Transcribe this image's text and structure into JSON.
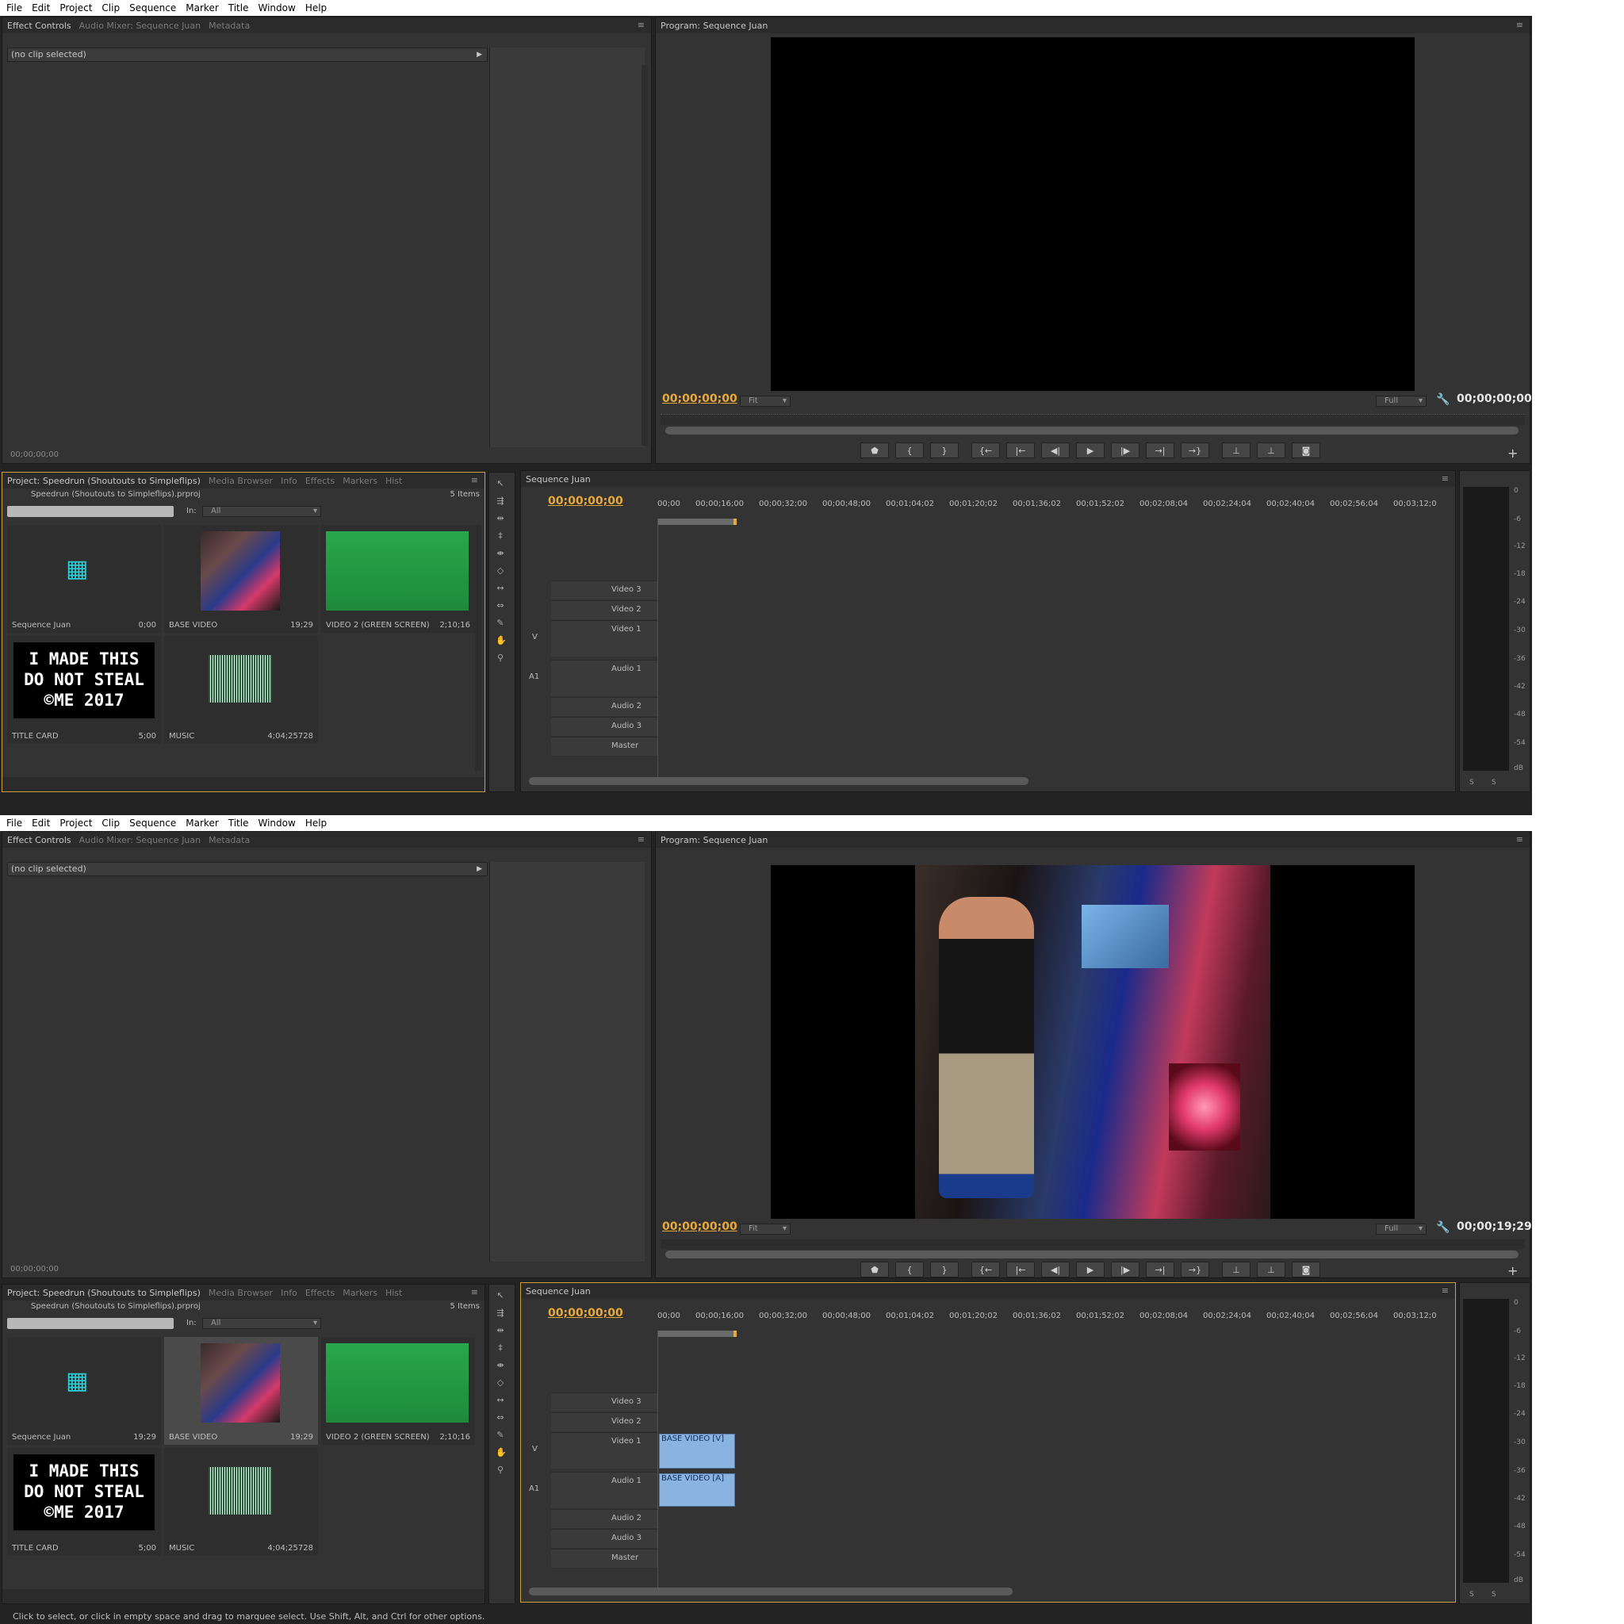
{
  "menu": [
    "File",
    "Edit",
    "Project",
    "Clip",
    "Sequence",
    "Marker",
    "Title",
    "Window",
    "Help"
  ],
  "effect_tabs": [
    "Effect Controls",
    "Audio Mixer: Sequence Juan",
    "Metadata"
  ],
  "no_clip": "(no clip selected)",
  "effect_time": "00;00;00;00",
  "program_tab": "Program: Sequence Juan",
  "program_in_time": "00;00;00;00",
  "fit": "Fit",
  "full": "Full",
  "project_tabs": [
    "Project: Speedrun (Shoutouts to Simpleflips)",
    "Media Browser",
    "Info",
    "Effects",
    "Markers",
    "Hist"
  ],
  "project_file": "Speedrun (Shoutouts to Simpleflips).prproj",
  "items_count": "5 Items",
  "in_label": "In:",
  "in_value": "All",
  "timeline_tab": "Sequence Juan",
  "timeline_time": "00;00;00;00",
  "ruler": [
    "00;00",
    "00;00;16;00",
    "00;00;32;00",
    "00;00;48;00",
    "00;01;04;02",
    "00;01;20;02",
    "00;01;36;02",
    "00;01;52;02",
    "00;02;08;04",
    "00;02;24;04",
    "00;02;40;04",
    "00;02;56;04",
    "00;03;12;0"
  ],
  "tracks": {
    "video": [
      "Video 3",
      "Video 2",
      "Video 1"
    ],
    "audio": [
      "Audio 1",
      "Audio 2",
      "Audio 3",
      "Master"
    ],
    "v": "V",
    "a1": "A1"
  },
  "meter_labels": [
    "0",
    "-6",
    "-12",
    "-18",
    "-24",
    "-30",
    "-36",
    "-42",
    "-48",
    "-54",
    "dB"
  ],
  "meter_solo": "S",
  "shots": [
    {
      "program_out_time": "00;00;00;00",
      "items": [
        {
          "name": "Sequence Juan",
          "dur": "0;00"
        },
        {
          "name": "BASE VIDEO",
          "dur": "19;29"
        },
        {
          "name": "VIDEO 2 (GREEN SCREEN)",
          "dur": "2;10;16"
        },
        {
          "name": "TITLE CARD",
          "dur": "5;00"
        },
        {
          "name": "MUSIC",
          "dur": "4;04;25728"
        }
      ]
    },
    {
      "program_out_time": "00;00;19;29",
      "items": [
        {
          "name": "Sequence Juan",
          "dur": "19;29"
        },
        {
          "name": "BASE VIDEO",
          "dur": "19;29"
        },
        {
          "name": "VIDEO 2 (GREEN SCREEN)",
          "dur": "2;10;16"
        },
        {
          "name": "TITLE CARD",
          "dur": "5;00"
        },
        {
          "name": "MUSIC",
          "dur": "4;04;25728"
        }
      ],
      "clip_video": "BASE VIDEO [V]",
      "clip_audio": "BASE VIDEO [A]",
      "status": "Click to select, or click in empty space and drag to marquee select. Use Shift, Alt, and Ctrl for other options."
    }
  ],
  "title_card_lines": [
    "I MADE THIS",
    "DO NOT STEAL",
    "©ME 2017"
  ]
}
